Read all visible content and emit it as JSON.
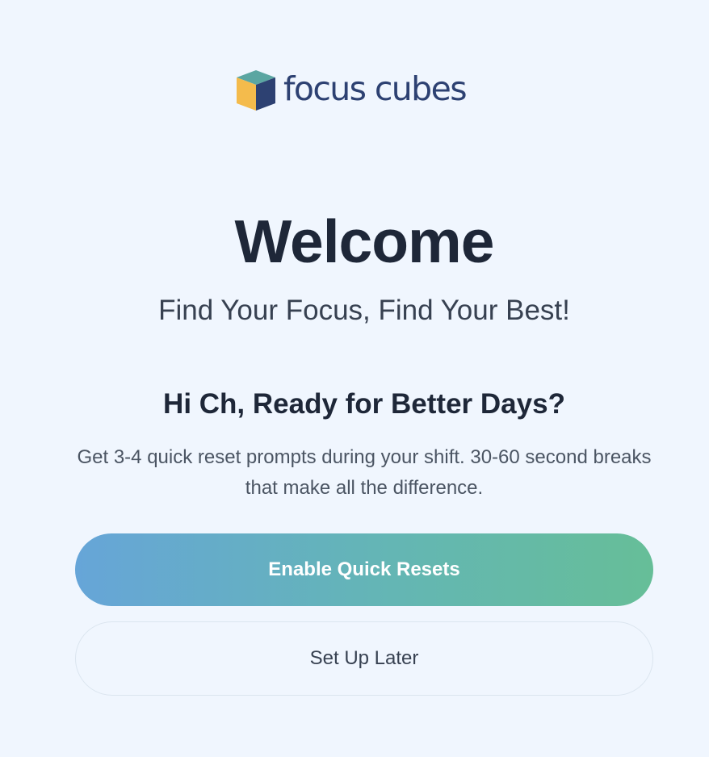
{
  "brand": {
    "name": "focus cubes",
    "logo_icon": "cube-icon",
    "colors": {
      "cube_top": "#5ba6a2",
      "cube_left": "#f4bb4c",
      "cube_right": "#2d4172",
      "text": "#2d4172"
    }
  },
  "welcome": {
    "title": "Welcome",
    "tagline": "Find Your Focus, Find Your Best!"
  },
  "onboarding": {
    "greeting": "Hi Ch, Ready for Better Days?",
    "description": "Get 3-4 quick reset prompts during your shift. 30-60 second breaks that make all the difference."
  },
  "actions": {
    "primary_label": "Enable Quick Resets",
    "secondary_label": "Set Up Later"
  },
  "theme": {
    "background": "#f0f6fe",
    "gradient_start": "#66a5d8",
    "gradient_end": "#66be98",
    "heading": "#1e2738"
  }
}
